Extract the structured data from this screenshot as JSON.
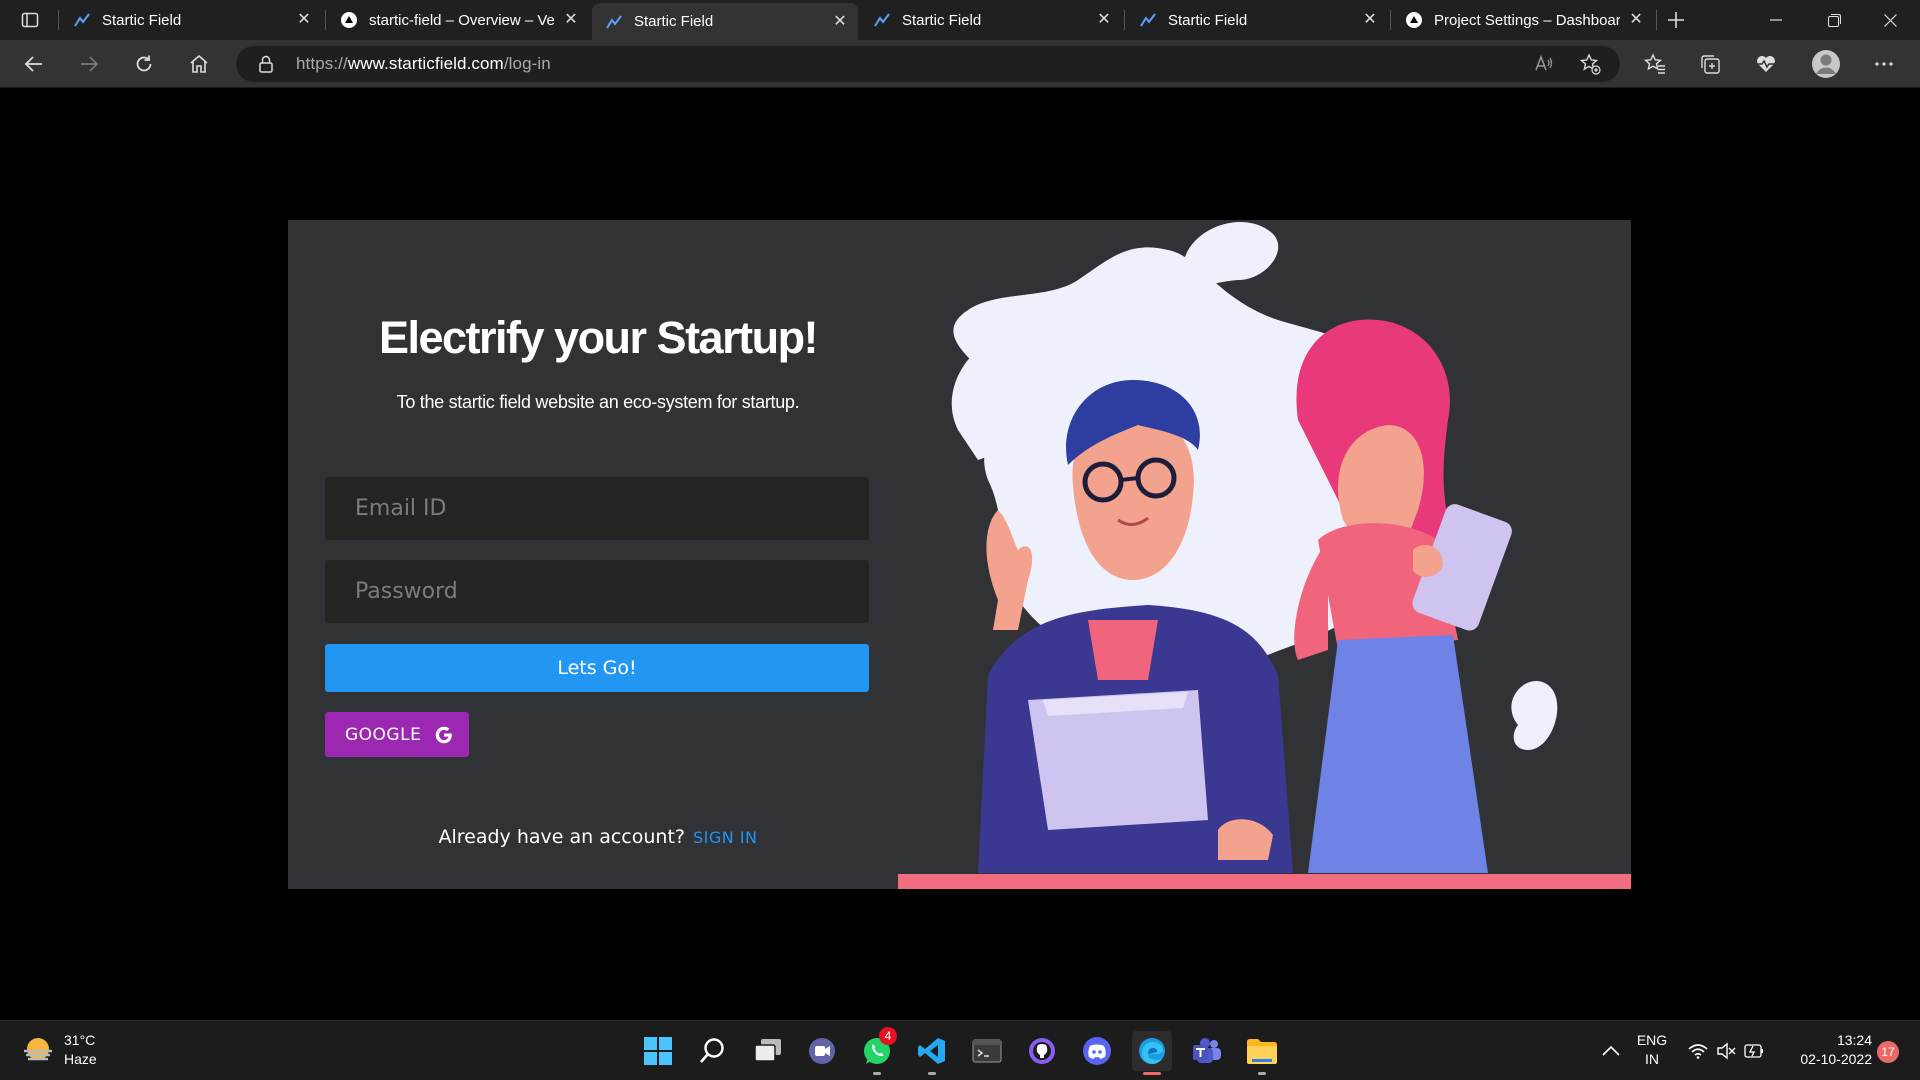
{
  "browser": {
    "tabs": [
      {
        "title": "Startic Field",
        "favicon": "startic-logo",
        "active": false
      },
      {
        "title": "startic-field – Overview – Ve",
        "favicon": "vercel-triangle",
        "active": false
      },
      {
        "title": "Startic Field",
        "favicon": "startic-logo",
        "active": true
      },
      {
        "title": "Startic Field",
        "favicon": "startic-logo",
        "active": false
      },
      {
        "title": "Startic Field",
        "favicon": "startic-logo",
        "active": false
      },
      {
        "title": "Project Settings – Dashboar",
        "favicon": "vercel-triangle",
        "active": false
      }
    ],
    "url": {
      "prefix": "https://",
      "host": "www.starticfield.com",
      "path": "/log-in"
    }
  },
  "page": {
    "headline": "Electrify your Startup!",
    "subline": "To the startic field website an eco-system for startup.",
    "email_placeholder": "Email ID",
    "password_placeholder": "Password",
    "submit_label": "Lets Go!",
    "google_label": "GOOGLE",
    "already_text": "Already have an account?",
    "signin_label": "SIGN IN"
  },
  "taskbar": {
    "weather": {
      "temp": "31°C",
      "condition": "Haze"
    },
    "apps": [
      "windows-start",
      "search",
      "task-view",
      "teams-chat",
      "whatsapp",
      "vscode",
      "terminal",
      "github-desktop",
      "discord",
      "edge",
      "teams",
      "file-explorer"
    ],
    "whatsapp_badge": "4",
    "language": {
      "line1": "ENG",
      "line2": "IN"
    },
    "clock": {
      "time": "13:24",
      "date": "02-10-2022"
    },
    "notifications": "17"
  },
  "colors": {
    "primary": "#2196f3",
    "google": "#9c27b0",
    "card": "#303236",
    "accent_pink": "#f26d7f"
  }
}
